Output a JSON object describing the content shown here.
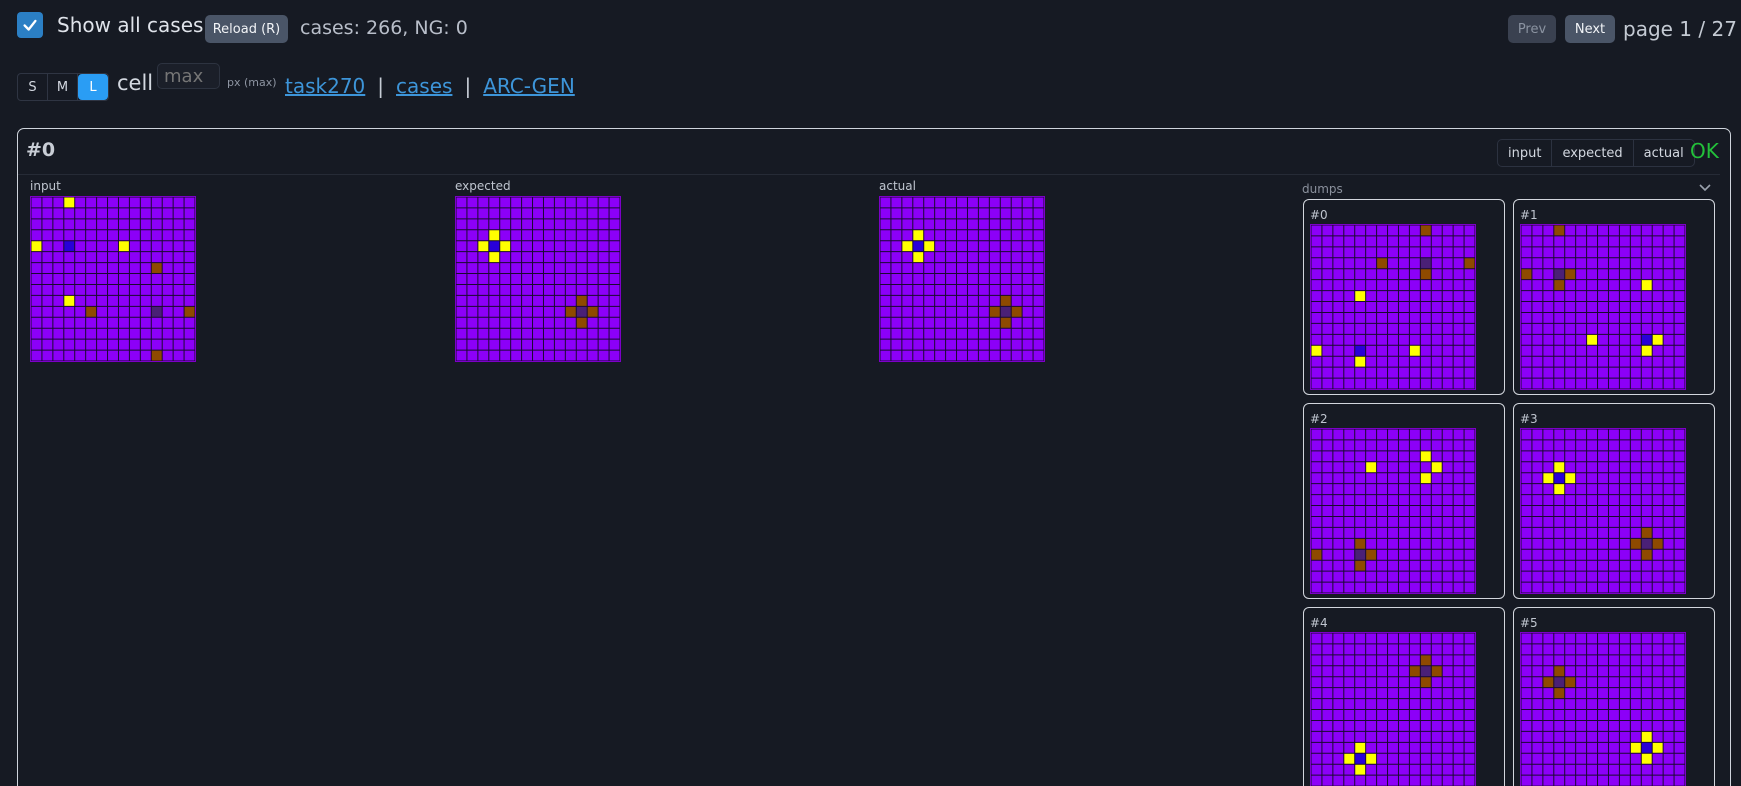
{
  "colors": {
    "cell_bg": "#8c00f8",
    "grid_line": "#1a0930",
    "yellow": "#ffff00",
    "brown": "#8e4a00",
    "blue": "#2800d8",
    "dark": "#4a2076",
    "ok": "#23c03a",
    "link": "#3d95d9"
  },
  "header": {
    "show_all_label": "Show all cases",
    "reload_label": "Reload (R)",
    "stats": "cases: 266, NG: 0",
    "prev_label": "Prev",
    "next_label": "Next",
    "page_info": "page 1 / 27"
  },
  "toolbar": {
    "sizes": [
      "S",
      "M",
      "L"
    ],
    "active_size": "L",
    "cell_label": "cell",
    "cell_placeholder": "max",
    "px_label": "px (max)",
    "links": [
      "task270",
      "cases",
      "ARC-GEN"
    ]
  },
  "case": {
    "title": "#0",
    "tabs": [
      "input",
      "expected",
      "actual"
    ],
    "status": "OK",
    "dumps_label": "dumps"
  },
  "grids": {
    "input": {
      "label": "input",
      "cells": [
        [
          0,
          3,
          "Y"
        ],
        [
          4,
          0,
          "Y"
        ],
        [
          4,
          3,
          "B"
        ],
        [
          4,
          8,
          "Y"
        ],
        [
          6,
          11,
          "N"
        ],
        [
          9,
          3,
          "Y"
        ],
        [
          10,
          5,
          "N"
        ],
        [
          10,
          11,
          "D"
        ],
        [
          10,
          14,
          "N"
        ],
        [
          14,
          11,
          "N"
        ]
      ]
    },
    "expected": {
      "label": "expected",
      "cells": [
        [
          3,
          3,
          "Y"
        ],
        [
          4,
          2,
          "Y"
        ],
        [
          4,
          3,
          "B"
        ],
        [
          4,
          4,
          "Y"
        ],
        [
          5,
          3,
          "Y"
        ],
        [
          9,
          11,
          "N"
        ],
        [
          10,
          10,
          "N"
        ],
        [
          10,
          11,
          "D"
        ],
        [
          10,
          12,
          "N"
        ],
        [
          11,
          11,
          "N"
        ]
      ]
    },
    "actual": {
      "label": "actual",
      "cells": [
        [
          3,
          3,
          "Y"
        ],
        [
          4,
          2,
          "Y"
        ],
        [
          4,
          3,
          "B"
        ],
        [
          4,
          4,
          "Y"
        ],
        [
          5,
          3,
          "Y"
        ],
        [
          9,
          11,
          "N"
        ],
        [
          10,
          10,
          "N"
        ],
        [
          10,
          11,
          "D"
        ],
        [
          10,
          12,
          "N"
        ],
        [
          11,
          11,
          "N"
        ]
      ]
    }
  },
  "dumps": [
    {
      "label": "#0",
      "cells": [
        [
          0,
          10,
          "N"
        ],
        [
          3,
          6,
          "N"
        ],
        [
          3,
          10,
          "D"
        ],
        [
          3,
          14,
          "N"
        ],
        [
          4,
          10,
          "N"
        ],
        [
          6,
          4,
          "Y"
        ],
        [
          11,
          0,
          "Y"
        ],
        [
          11,
          4,
          "B"
        ],
        [
          11,
          9,
          "Y"
        ],
        [
          12,
          4,
          "Y"
        ]
      ]
    },
    {
      "label": "#1",
      "cells": [
        [
          0,
          3,
          "N"
        ],
        [
          4,
          0,
          "N"
        ],
        [
          4,
          3,
          "D"
        ],
        [
          4,
          4,
          "N"
        ],
        [
          5,
          3,
          "N"
        ],
        [
          5,
          11,
          "Y"
        ],
        [
          10,
          6,
          "Y"
        ],
        [
          10,
          11,
          "B"
        ],
        [
          10,
          12,
          "Y"
        ],
        [
          11,
          11,
          "Y"
        ]
      ]
    },
    {
      "label": "#2",
      "cells": [
        [
          2,
          10,
          "Y"
        ],
        [
          3,
          5,
          "Y"
        ],
        [
          3,
          11,
          "Y"
        ],
        [
          4,
          10,
          "Y"
        ],
        [
          10,
          4,
          "N"
        ],
        [
          11,
          0,
          "N"
        ],
        [
          11,
          4,
          "D"
        ],
        [
          11,
          5,
          "N"
        ],
        [
          12,
          4,
          "N"
        ]
      ]
    },
    {
      "label": "#3",
      "cells": [
        [
          3,
          3,
          "Y"
        ],
        [
          4,
          2,
          "Y"
        ],
        [
          4,
          3,
          "B"
        ],
        [
          4,
          4,
          "Y"
        ],
        [
          5,
          3,
          "Y"
        ],
        [
          9,
          11,
          "N"
        ],
        [
          10,
          10,
          "N"
        ],
        [
          10,
          11,
          "D"
        ],
        [
          10,
          12,
          "N"
        ],
        [
          11,
          11,
          "N"
        ]
      ]
    },
    {
      "label": "#4",
      "cells": [
        [
          2,
          10,
          "N"
        ],
        [
          3,
          9,
          "N"
        ],
        [
          3,
          10,
          "D"
        ],
        [
          3,
          11,
          "N"
        ],
        [
          4,
          10,
          "N"
        ],
        [
          10,
          4,
          "Y"
        ],
        [
          11,
          3,
          "Y"
        ],
        [
          11,
          4,
          "B"
        ],
        [
          11,
          5,
          "Y"
        ],
        [
          12,
          4,
          "Y"
        ]
      ]
    },
    {
      "label": "#5",
      "cells": [
        [
          3,
          3,
          "N"
        ],
        [
          4,
          2,
          "N"
        ],
        [
          4,
          3,
          "D"
        ],
        [
          4,
          4,
          "N"
        ],
        [
          5,
          3,
          "N"
        ],
        [
          9,
          11,
          "Y"
        ],
        [
          10,
          10,
          "Y"
        ],
        [
          10,
          11,
          "B"
        ],
        [
          10,
          12,
          "Y"
        ],
        [
          11,
          11,
          "Y"
        ]
      ]
    }
  ]
}
